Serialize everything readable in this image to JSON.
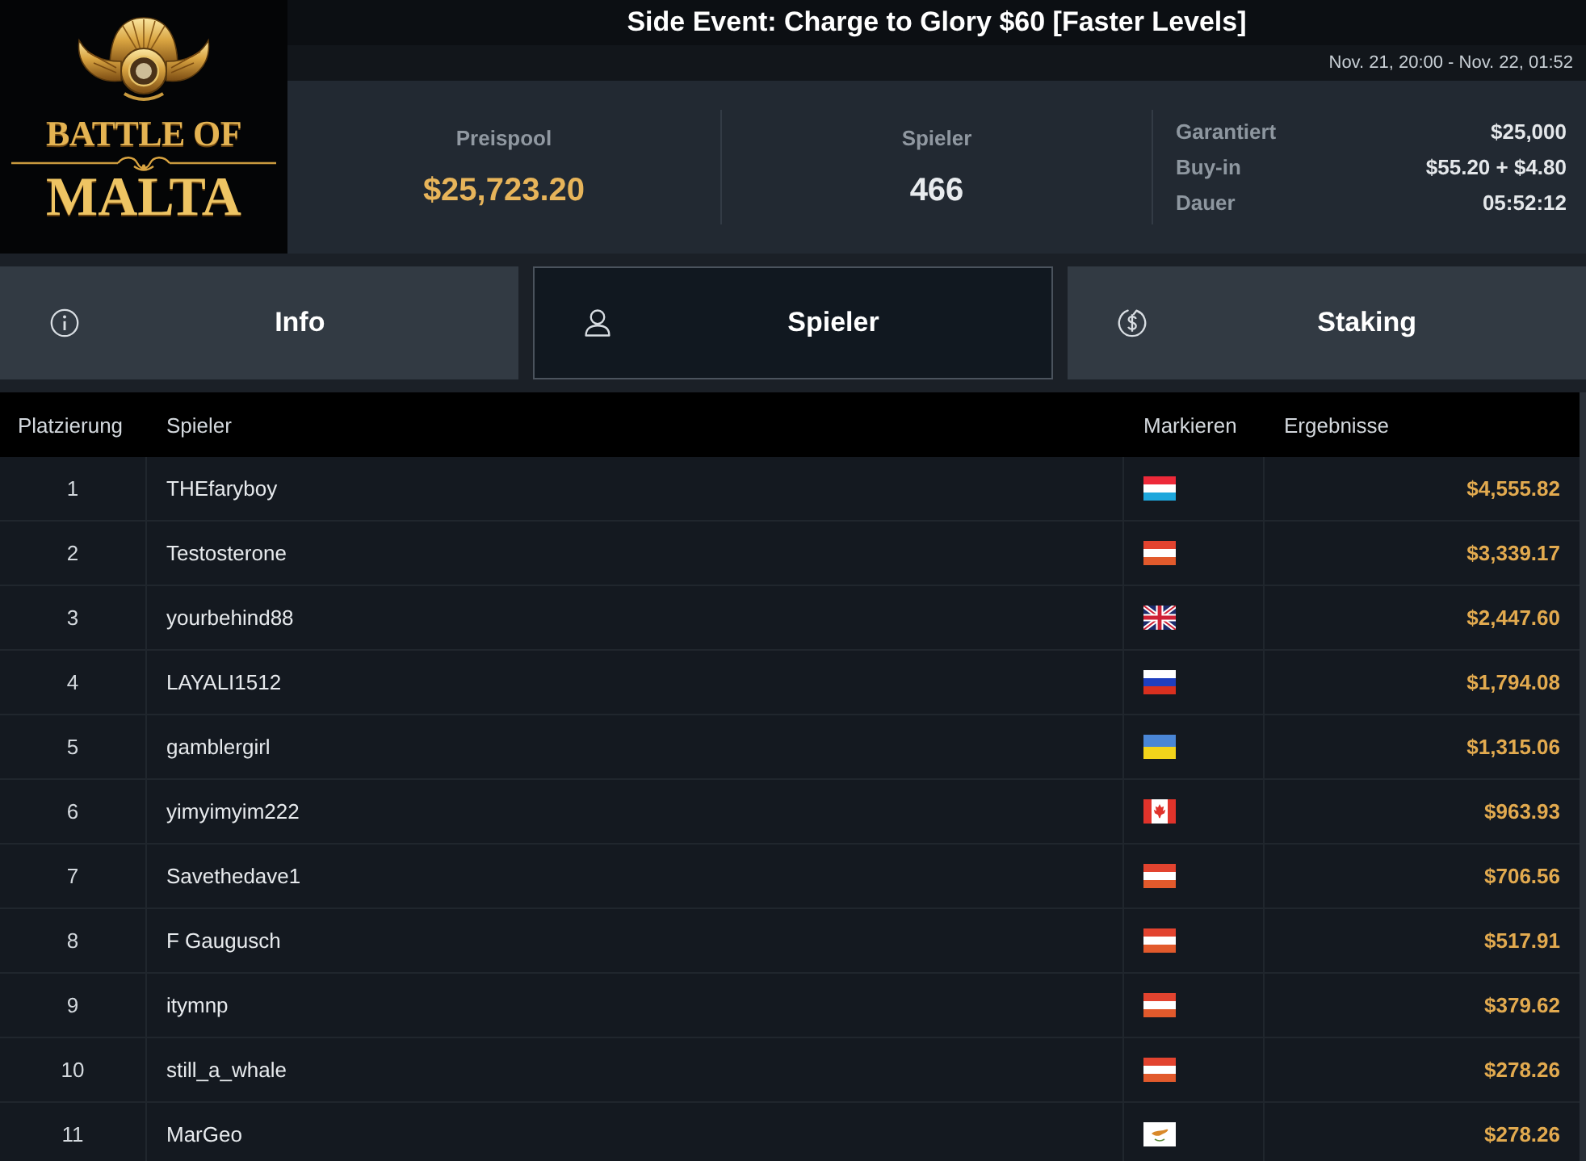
{
  "logo": {
    "line_1": "BATTLE OF",
    "line_2": "MALTA"
  },
  "header": {
    "title": "Side Event: Charge to Glory $60 [Faster Levels]",
    "dates": "Nov. 21, 20:00 - Nov. 22, 01:52"
  },
  "stats": [
    {
      "label": "Preispool",
      "value": "$25,723.20",
      "kind": "money"
    },
    {
      "label": "Spieler",
      "value": "466",
      "kind": "count"
    }
  ],
  "details": [
    {
      "label": "Garantiert",
      "value": "$25,000"
    },
    {
      "label": "Buy-in",
      "value": "$55.20 + $4.80"
    },
    {
      "label": "Dauer",
      "value": "05:52:12"
    }
  ],
  "tabs": [
    {
      "label": "Info",
      "kind": "info",
      "selected": false
    },
    {
      "label": "Spieler",
      "kind": "players",
      "selected": true
    },
    {
      "label": "Staking",
      "kind": "staking",
      "selected": false
    }
  ],
  "table": {
    "columns": [
      "Platzierung",
      "Spieler",
      "Markieren",
      "Ergebnisse"
    ],
    "rows": [
      {
        "rank": "1",
        "player": "THEfaryboy",
        "flag": {
          "kind": "lu"
        },
        "result": "$4,555.82"
      },
      {
        "rank": "2",
        "player": "Testosterone",
        "flag": {
          "kind": "at"
        },
        "result": "$3,339.17"
      },
      {
        "rank": "3",
        "player": "yourbehind88",
        "flag": {
          "kind": "gb"
        },
        "result": "$2,447.60"
      },
      {
        "rank": "4",
        "player": "LAYALI1512",
        "flag": {
          "kind": "ru"
        },
        "result": "$1,794.08"
      },
      {
        "rank": "5",
        "player": "gamblergirl",
        "flag": {
          "kind": "ua"
        },
        "result": "$1,315.06"
      },
      {
        "rank": "6",
        "player": "yimyimyim222",
        "flag": {
          "kind": "ca"
        },
        "result": "$963.93"
      },
      {
        "rank": "7",
        "player": "Savethedave1",
        "flag": {
          "kind": "at"
        },
        "result": "$706.56"
      },
      {
        "rank": "8",
        "player": "F Gaugusch",
        "flag": {
          "kind": "at"
        },
        "result": "$517.91"
      },
      {
        "rank": "9",
        "player": "itymnp",
        "flag": {
          "kind": "at"
        },
        "result": "$379.62"
      },
      {
        "rank": "10",
        "player": "still_a_whale",
        "flag": {
          "kind": "at"
        },
        "result": "$278.26"
      },
      {
        "rank": "11",
        "player": "MarGeo",
        "flag": {
          "kind": "cy"
        },
        "result": "$278.26"
      }
    ]
  }
}
